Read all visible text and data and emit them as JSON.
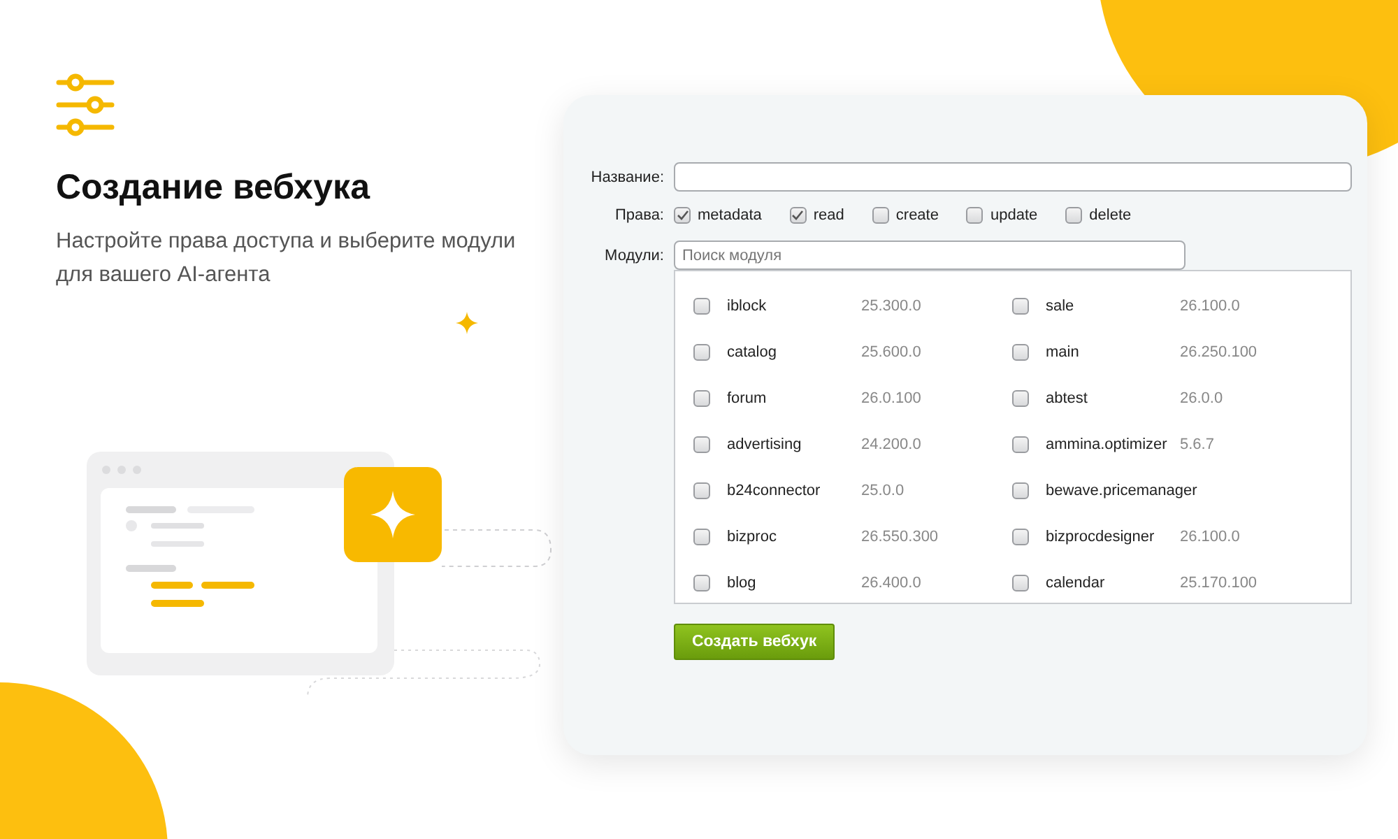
{
  "intro": {
    "title": "Создание вебхука",
    "subtitle": "Настройте права доступа и выберите модули для вашего AI-агента"
  },
  "form": {
    "name_label": "Название:",
    "rights_label": "Права:",
    "rights": [
      {
        "label": "metadata",
        "checked": true
      },
      {
        "label": "read",
        "checked": true
      },
      {
        "label": "create",
        "checked": false
      },
      {
        "label": "update",
        "checked": false
      },
      {
        "label": "delete",
        "checked": false
      }
    ],
    "modules_label": "Модули:",
    "search": {
      "placeholder": "Поиск модуля"
    },
    "modules": [
      {
        "name": "iblock",
        "version": "25.300.0",
        "checked": false
      },
      {
        "name": "sale",
        "version": "26.100.0",
        "checked": false
      },
      {
        "name": "catalog",
        "version": "25.600.0",
        "checked": false
      },
      {
        "name": "main",
        "version": "26.250.100",
        "checked": false
      },
      {
        "name": "forum",
        "version": "26.0.100",
        "checked": false
      },
      {
        "name": "abtest",
        "version": "26.0.0",
        "checked": false
      },
      {
        "name": "advertising",
        "version": "24.200.0",
        "checked": false
      },
      {
        "name": "ammina.optimizer",
        "version": "5.6.7",
        "checked": false
      },
      {
        "name": "b24connector",
        "version": "25.0.0",
        "checked": false
      },
      {
        "name": "bewave.pricemanager",
        "checked": false
      },
      {
        "name": "bizproc",
        "version": "26.550.300",
        "checked": false
      },
      {
        "name": "bizprocdesigner",
        "version": "26.100.0",
        "checked": false
      },
      {
        "name": "blog",
        "version": "26.400.0",
        "checked": false
      },
      {
        "name": "calendar",
        "version": "25.170.100",
        "checked": false
      }
    ],
    "submit": "Создать вебхук"
  }
}
